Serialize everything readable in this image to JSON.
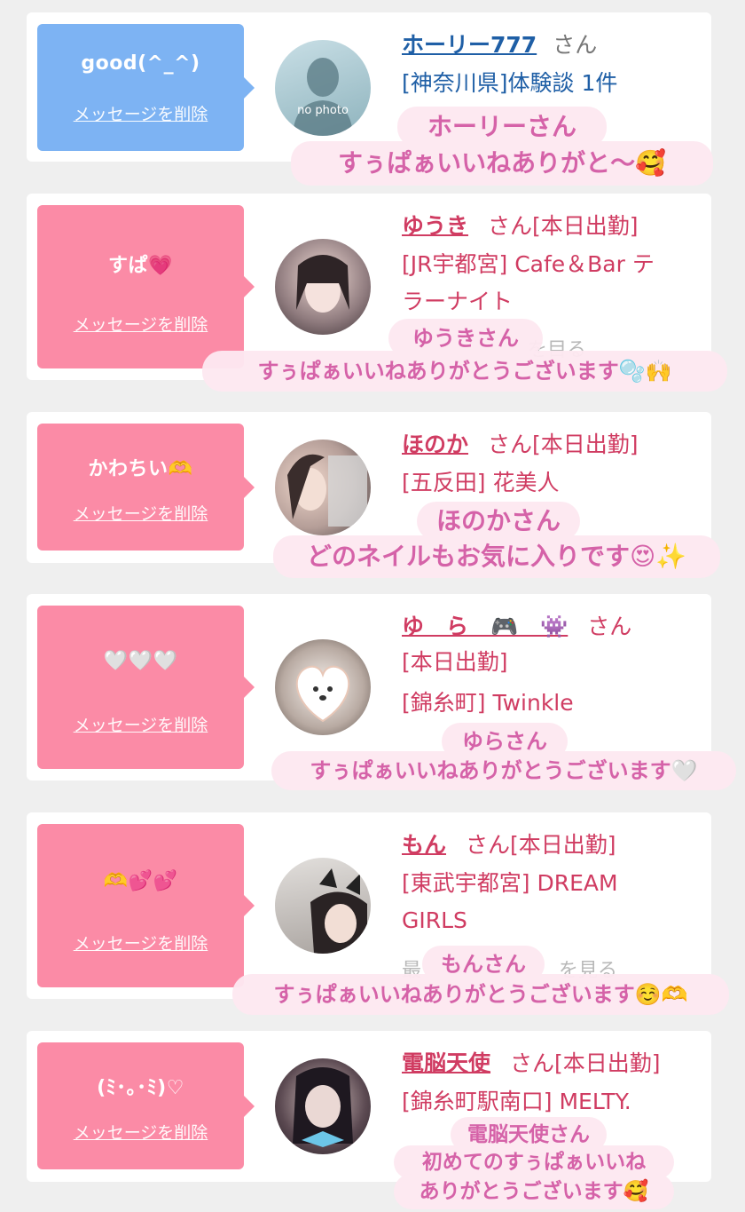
{
  "colors": {
    "pink_bubble": "#fb8ba6",
    "blue_bubble": "#7db3f3",
    "name_pink": "#d03c62",
    "name_blue": "#1f5fa6"
  },
  "cards": [
    {
      "bubble_message": "good(^_^)",
      "delete_label": "メッセージを削除",
      "name": "ホーリー777",
      "san": "さん",
      "info_lines": [
        "[神奈川県]体験談 1件"
      ],
      "avatar_caption": "no photo",
      "sticker_lines": [
        "ホーリーさん",
        "すぅぱぁいいねありがと〜🥰"
      ]
    },
    {
      "bubble_message": "すぱ💗",
      "delete_label": "メッセージを削除",
      "name": "ゆうき",
      "san": "さん[本日出勤]",
      "info_lines": [
        "[JR宇都宮] Cafe＆Bar テ",
        "ラーナイト"
      ],
      "sticker_lines": [
        "ゆうきさん",
        "すぅぱぁいいねありがとうございます🫧🙌"
      ]
    },
    {
      "bubble_message": "かわちい🫶",
      "delete_label": "メッセージを削除",
      "name": "ほのか",
      "san": "さん[本日出勤]",
      "info_lines": [
        "[五反田] 花美人"
      ],
      "sticker_lines": [
        "ほのかさん",
        "どのネイルもお気に入りです😍✨"
      ]
    },
    {
      "bubble_message": "🤍🤍🤍",
      "delete_label": "メッセージを削除",
      "name": "ゆ　ら　🎮　👾",
      "san": "さん",
      "info_lines": [
        "[本日出勤]",
        "[錦糸町] Twinkle"
      ],
      "sticker_lines": [
        "ゆらさん",
        "すぅぱぁいいねありがとうございます🤍"
      ]
    },
    {
      "bubble_message": "🫶💕💕",
      "delete_label": "メッセージを削除",
      "name": "もん",
      "san": "さん[本日出勤]",
      "info_lines": [
        "[東武宇都宮] DREAM",
        "GIRLS"
      ],
      "sticker_lines": [
        "もんさん",
        "すぅぱぁいいねありがとうございます☺️🫶"
      ]
    },
    {
      "bubble_message": "(ﾐ･｡･ﾐ)♡",
      "delete_label": "メッセージを削除",
      "name": "電脳天使",
      "san": "さん[本日出勤]",
      "info_lines": [
        "[錦糸町駅南口] MELTY."
      ],
      "sticker_lines": [
        "電脳天使さん",
        "初めてのすぅぱぁいいね",
        "ありがとうございます🥰"
      ]
    }
  ]
}
